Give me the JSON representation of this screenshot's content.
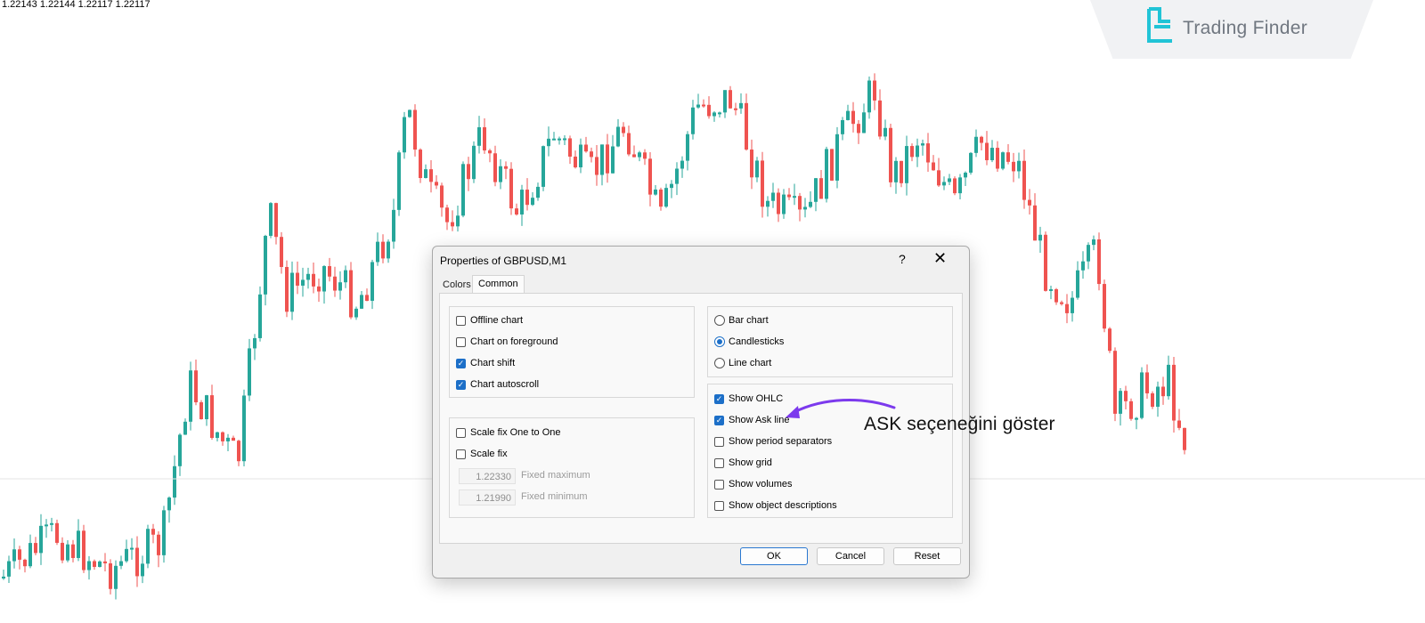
{
  "ohlc_text": "1.22143 1.22144 1.22117 1.22117",
  "brand": {
    "name": "Trading Finder",
    "logo_icon": "trading-finder-logo-icon"
  },
  "colors": {
    "bull": "#26a69a",
    "bear": "#ef5350",
    "accent": "#1c6fc8",
    "arrow": "#7c3aed"
  },
  "dialog": {
    "title": "Properties of GBPUSD,M1",
    "help": "?",
    "close": "✕",
    "tabs": [
      {
        "label": "Colors",
        "active": false
      },
      {
        "label": "Common",
        "active": true
      }
    ],
    "left_group_1": [
      {
        "label": "Offline chart",
        "checked": false
      },
      {
        "label": "Chart on foreground",
        "checked": false
      },
      {
        "label": "Chart shift",
        "checked": true
      },
      {
        "label": "Chart autoscroll",
        "checked": true
      }
    ],
    "left_group_2": [
      {
        "label": "Scale fix One to One",
        "checked": false
      },
      {
        "label": "Scale fix",
        "checked": false
      }
    ],
    "fixed_maximum": {
      "value": "1.22330",
      "label": "Fixed maximum"
    },
    "fixed_minimum": {
      "value": "1.21990",
      "label": "Fixed minimum"
    },
    "chart_types": [
      {
        "label": "Bar chart",
        "selected": false
      },
      {
        "label": "Candlesticks",
        "selected": true
      },
      {
        "label": "Line chart",
        "selected": false
      }
    ],
    "show_options": [
      {
        "label": "Show OHLC",
        "checked": true
      },
      {
        "label": "Show Ask line",
        "checked": true
      },
      {
        "label": "Show period separators",
        "checked": false
      },
      {
        "label": "Show grid",
        "checked": false
      },
      {
        "label": "Show volumes",
        "checked": false
      },
      {
        "label": "Show object descriptions",
        "checked": false
      }
    ],
    "buttons": {
      "ok": "OK",
      "cancel": "Cancel",
      "reset": "Reset"
    }
  },
  "annotation": "ASK seçeneğini göster"
}
